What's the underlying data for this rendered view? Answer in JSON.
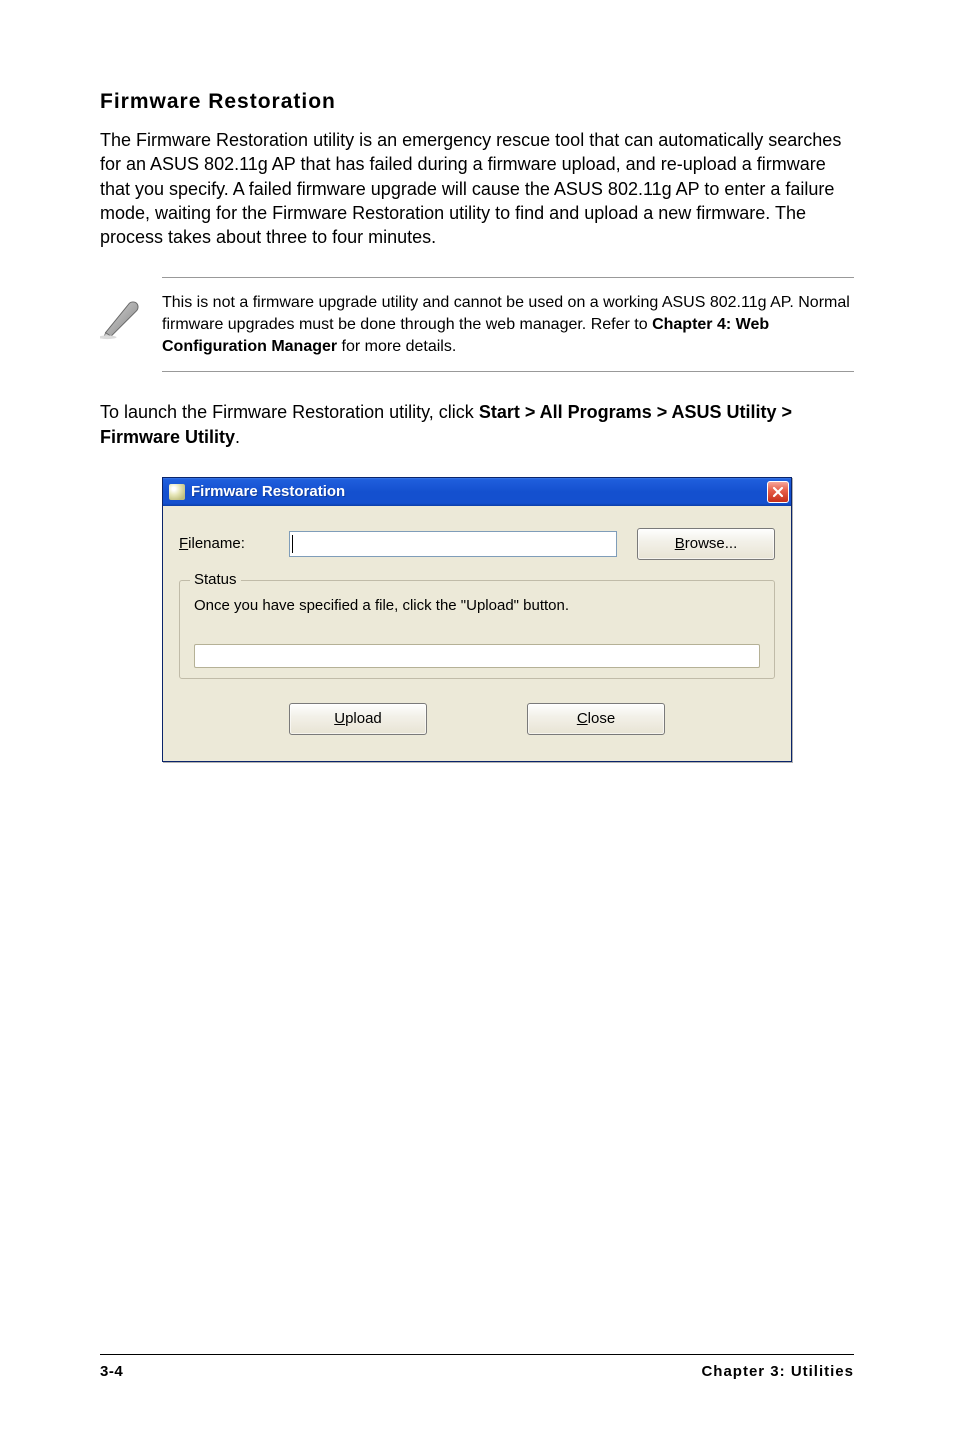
{
  "section": {
    "title": "Firmware Restoration",
    "paragraph": "The Firmware Restoration utility is an emergency rescue tool that can automatically searches for an ASUS 802.11g AP that has failed during a firmware upload, and re-upload a firmware that you specify. A failed firmware upgrade will cause the ASUS 802.11g AP to enter a failure mode, waiting for the Firmware Restoration utility to find and upload a new firmware. The process takes about three to four minutes."
  },
  "note": {
    "text_pre": "This is not a firmware upgrade utility and cannot be used on a working ASUS 802.11g AP. Normal firmware upgrades must be done through the web manager. Refer to ",
    "text_bold": "Chapter 4: Web Configuration Manager",
    "text_post": " for more details."
  },
  "instruction": {
    "pre": "To launch the Firmware Restoration utility, click ",
    "bold": "Start > All Programs > ASUS Utility > Firmware Utility",
    "post": "."
  },
  "dialog": {
    "title": "Firmware Restoration",
    "filename_label_u": "F",
    "filename_label_rest": "ilename:",
    "filename_value": "",
    "browse_u": "B",
    "browse_rest": "rowse...",
    "status_legend": "Status",
    "status_text": "Once you have specified a file, click the \"Upload\" button.",
    "upload_u": "U",
    "upload_rest": "pload",
    "close_u": "C",
    "close_rest": "lose"
  },
  "footer": {
    "page": "3-4",
    "chapter": "Chapter 3: Utilities"
  }
}
